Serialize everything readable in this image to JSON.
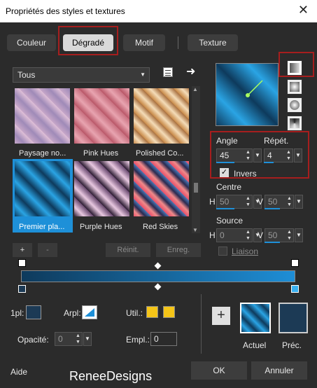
{
  "window": {
    "title": "Propriétés des styles et textures",
    "close_icon": "close-icon"
  },
  "tabs": [
    "Couleur",
    "Dégradé",
    "Motif",
    "Texture"
  ],
  "category": {
    "selected": "Tous"
  },
  "gradients": [
    {
      "label": "Paysage no...",
      "selected": false
    },
    {
      "label": "Pink Hues",
      "selected": false
    },
    {
      "label": "Polished Co...",
      "selected": false
    },
    {
      "label": "Premier pla...",
      "selected": true
    },
    {
      "label": "Purple Hues",
      "selected": false
    },
    {
      "label": "Red Skies",
      "selected": false
    }
  ],
  "list_buttons": {
    "add": "+",
    "remove": "-",
    "reset": "Réinit.",
    "save": "Enreg."
  },
  "angle": {
    "label": "Angle",
    "value": "45"
  },
  "repeat": {
    "label": "Répét.",
    "value": "4"
  },
  "invert": {
    "label": "Invers",
    "checked": true
  },
  "center": {
    "label": "Centre",
    "h_label": "H",
    "h_value": "50",
    "v_label": "V",
    "v_value": "50"
  },
  "source": {
    "label": "Source",
    "h_label": "H",
    "h_value": "0",
    "v_label": "V",
    "v_value": "50"
  },
  "link": {
    "label": "Liaison",
    "checked": false
  },
  "bottom": {
    "first_plane_label": "1pl:",
    "back_plane_label": "Arpl:",
    "util_label": "Util.:",
    "opacity_label": "Opacité:",
    "opacity_value": "0",
    "empl_label": "Empl.:",
    "empl_value": "0"
  },
  "preview": {
    "current_label": "Actuel",
    "previous_label": "Préc."
  },
  "footer": {
    "help": "Aide",
    "watermark": "ReneeDesigns",
    "ok": "OK",
    "cancel": "Annuler"
  },
  "colors": {
    "accent_blue": "#1e90d8",
    "selected_red": "#a61e1e",
    "dark_navy": "#1c3a55",
    "yellow": "#f5c518"
  }
}
